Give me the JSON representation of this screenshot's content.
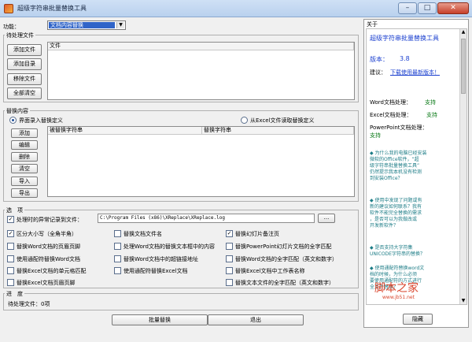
{
  "window": {
    "title": "超级字符串批量替换工具",
    "min": "–",
    "max": "□",
    "close": "✕"
  },
  "function_label": "功能：",
  "function_select": "文档内容替换",
  "pending_files": {
    "title": "待处理文件",
    "buttons": [
      "添加文件",
      "添加目录",
      "移除文件",
      "全部清空"
    ],
    "column": "文件"
  },
  "replace_content": {
    "title": "替换内容",
    "radio_manual": "界面录入替换定义",
    "radio_excel": "从Excel文件读取替换定义",
    "buttons": [
      "添加",
      "编辑",
      "删除",
      "清空",
      "导入",
      "导出"
    ],
    "columns": [
      "被替换字符串",
      "替换字符串"
    ]
  },
  "options": {
    "title": "选　项",
    "log_checkbox": "处理时的异常记录到文件：",
    "log_path": "C:\\Program Files (x86)\\XReplace\\XReplace.log",
    "browse": "...",
    "items": [
      {
        "label": "区分大小写（全角半角）",
        "checked": true
      },
      {
        "label": "替换文档文件名",
        "checked": false
      },
      {
        "label": "替换幻灯片备注页",
        "checked": true
      },
      {
        "label": "替换Word文档的页眉页脚",
        "checked": false
      },
      {
        "label": "处理Word文档的替换文本框中的内容",
        "checked": false
      },
      {
        "label": "替换PowerPoint幻灯片文档的全字匹配",
        "checked": false
      },
      {
        "label": "使用通配符替换Word文档",
        "checked": false
      },
      {
        "label": "替换Word文档中的超链接地址",
        "checked": false
      },
      {
        "label": "替换Word文档的全字匹配（英文和数字）",
        "checked": false
      },
      {
        "label": "替换Excel文档的单元格匹配",
        "checked": false
      },
      {
        "label": "使用通配符替换Excel文档",
        "checked": false
      },
      {
        "label": "替换Excel文档中工作表名称",
        "checked": false
      },
      {
        "label": "替换Excel文档页眉页脚",
        "checked": false
      },
      {
        "label": "",
        "checked": false
      },
      {
        "label": "替换文本文件的全字匹配（英文和数字）",
        "checked": false
      }
    ]
  },
  "progress": {
    "title": "进　度",
    "status": "待处理文件：0项"
  },
  "bottom_buttons": {
    "batch": "批量替换",
    "exit": "退出"
  },
  "about": {
    "title": "关于",
    "app_name": "超级字符串批量替换工具",
    "version_label": "版本：",
    "version": "3.8",
    "suggest_label": "建议：",
    "download_link": "下载使用最新版本！",
    "support": [
      {
        "label": "Word文档处理：",
        "value": "支持"
      },
      {
        "label": "Excel文档处理：",
        "value": "支持"
      },
      {
        "label": "PowerPoint文档处理：",
        "value": "支持"
      }
    ],
    "faq1": [
      "◆ 为什么我的电脑已经安装",
      "微软的Office软件，“超",
      "级字符串批量替换工具”",
      "仍然提示我本机没有检测",
      "到安装Office？"
    ],
    "faq2": [
      "◆ 使用中发现了问题或有",
      "新的建议如何联系？我有",
      "软件不能完全替换的需求",
      "，是否可以为我做改或",
      "开发新软件？"
    ],
    "faq3": [
      "◆ 是否支持大字符集",
      "UNICODE字符串的替换？"
    ],
    "faq4": [
      "◆ 使用通配符替换word文",
      "档的时候，为什么必须",
      "要使用通配符的方式进行",
      "全文件替换？"
    ],
    "hide_button": "隐藏",
    "watermark": "脚本之家",
    "watermark_url": "www.jb51.net"
  }
}
